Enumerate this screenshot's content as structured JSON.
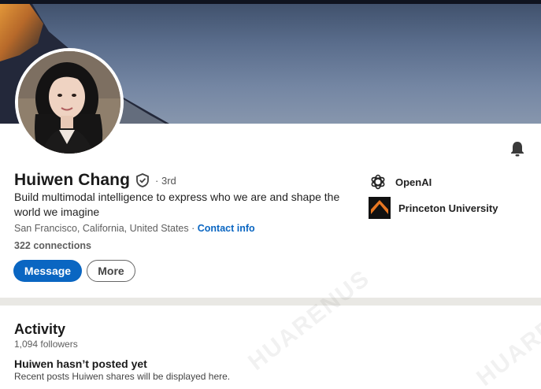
{
  "profile": {
    "name": "Huiwen Chang",
    "degree": "· 3rd",
    "headline": "Build multimodal intelligence to express who we are and shape the world we imagine",
    "location": "San Francisco, California, United States · ",
    "contact_label": "Contact info",
    "connections": "322 connections"
  },
  "actions": {
    "message_label": "Message",
    "more_label": "More"
  },
  "organizations": [
    {
      "name": "OpenAI",
      "icon": "openai-logo"
    },
    {
      "name": "Princeton University",
      "icon": "princeton-logo"
    }
  ],
  "activity": {
    "title": "Activity",
    "followers": "1,094 followers",
    "empty_title": "Huiwen hasn’t posted yet",
    "empty_subtitle": "Recent posts Huiwen shares will be displayed here."
  },
  "watermark": {
    "text": "HUARENUS"
  },
  "colors": {
    "accent": "#0a66c2",
    "background": "#e9e8e4",
    "card": "#ffffff"
  }
}
